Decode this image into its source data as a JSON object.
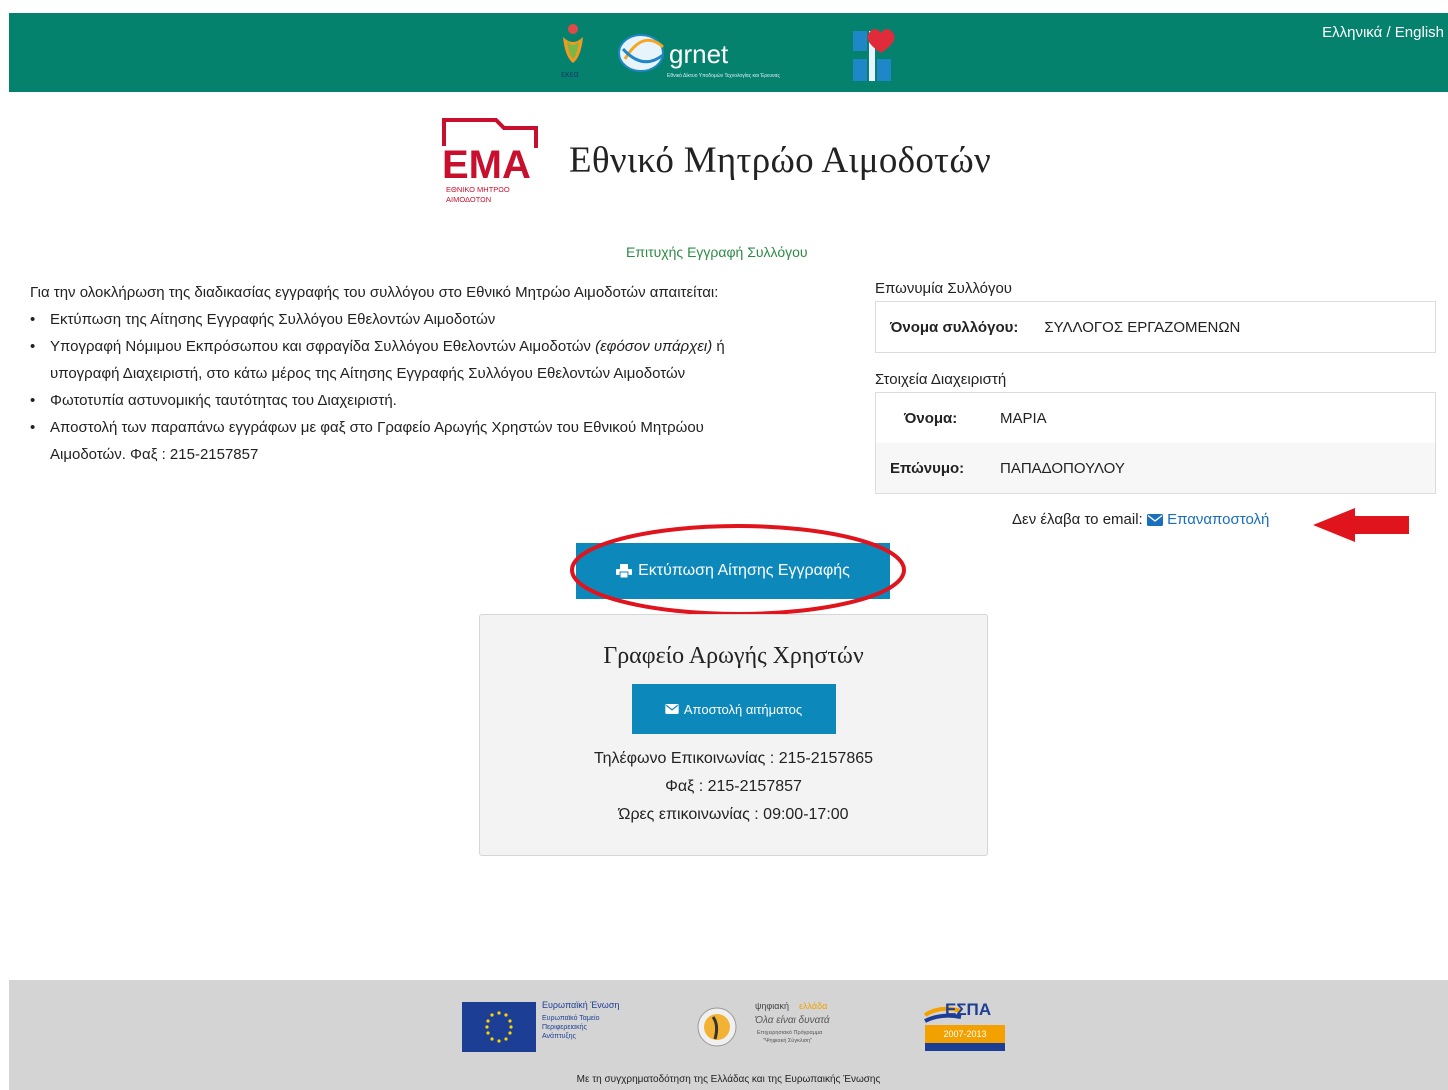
{
  "header": {
    "language_switch": "Ελληνικά / English",
    "logos": [
      "ekea-logo",
      "grnet-logo",
      "ministry-health-logo"
    ],
    "grnet_text": "grnet"
  },
  "title": {
    "logo_letters": "ΕΜΑ",
    "logo_sub1": "ΕΘΝΙΚΟ ΜΗΤΡΩΟ",
    "logo_sub2": "ΑΙΜΟΔΟΤΩΝ",
    "text": "Εθνικό Μητρώο Αιμοδοτών"
  },
  "success_message": "Επιτυχής Εγγραφή Συλλόγου",
  "instructions": {
    "intro": "Για την ολοκλήρωση της διαδικασίας εγγραφής του συλλόγου στο Εθνικό Μητρώο Αιμοδοτών απαιτείται:",
    "item1": "Εκτύπωση της Αίτησης Εγγραφής Συλλόγου Εθελοντών Αιμοδοτών",
    "item2_a": "Υπογραφή Νόμιμου Εκπρόσωπου και σφραγίδα Συλλόγου Εθελοντών Αιμοδοτών",
    "item2_em": "(εφόσον υπάρχει)",
    "item2_b": "ή",
    "item2_line2": "υπογραφή Διαχειριστή, στο κάτω μέρος της Αίτησης Εγγραφής Συλλόγου Εθελοντών Αιμοδοτών",
    "item3": "Φωτοτυπία αστυνομικής ταυτότητας του Διαχειριστή.",
    "item4": "Αποστολή των παραπάνω εγγράφων με φαξ στο Γραφείο Αρωγής Χρηστών του Εθνικού Μητρώου",
    "item4_line2": "Αιμοδοτών. Φαξ : 215-2157857",
    "bullet": "•"
  },
  "association": {
    "label": "Επωνυμία Συλλόγου",
    "name_key": "Όνομα συλλόγου:",
    "name_value": "ΣΥΛΛΟΓΟΣ ΕΡΓΑΖΟΜΕΝΩΝ"
  },
  "admin": {
    "label": "Στοιχεία Διαχειριστή",
    "first_key": "Όνομα:",
    "first_value": "ΜΑΡΙΑ",
    "last_key": "Επώνυμο:",
    "last_value": "ΠΑΠΑΔΟΠΟΥΛΟΥ"
  },
  "resend": {
    "prompt": "Δεν έλαβα το email:",
    "link": "Επαναποστολή"
  },
  "print_button": "Εκτύπωση Αίτησης Εγγραφής",
  "helpdesk": {
    "title": "Γραφείο Αρωγής Χρηστών",
    "request_button": "Αποστολή αιτήματος",
    "phone": "Τηλέφωνο Επικοινωνίας : 215-2157865",
    "fax": "Φαξ : 215-2157857",
    "hours": "Ώρες επικοινωνίας : 09:00-17:00"
  },
  "footer": {
    "eu_line1": "Ευρωπαϊκή Ένωση",
    "eu_line2": "Ευρωπαϊκό Ταμείο",
    "eu_line3": "Περιφερειακής",
    "eu_line4": "Ανάπτυξης",
    "digital_title_a": "ψηφιακή",
    "digital_title_b": "ελλάδα",
    "digital_slogan": "Όλα είναι δυνατά",
    "digital_sub1": "Επιχειρησιακό Πρόγραμμα",
    "digital_sub2": "\"Ψηφιακή Σύγκλιση\"",
    "espa_title": "ΕΣΠΑ",
    "espa_years": "2007-2013",
    "caption": "Με τη συγχρηματοδότηση της Ελλάδας και της Ευρωπαικής Ένωσης"
  },
  "colors": {
    "topbar": "#04826e",
    "primary_button": "#0c88bb",
    "success": "#2e8b46",
    "annotation_red": "#e0141c",
    "ema_red": "#c8102e"
  }
}
